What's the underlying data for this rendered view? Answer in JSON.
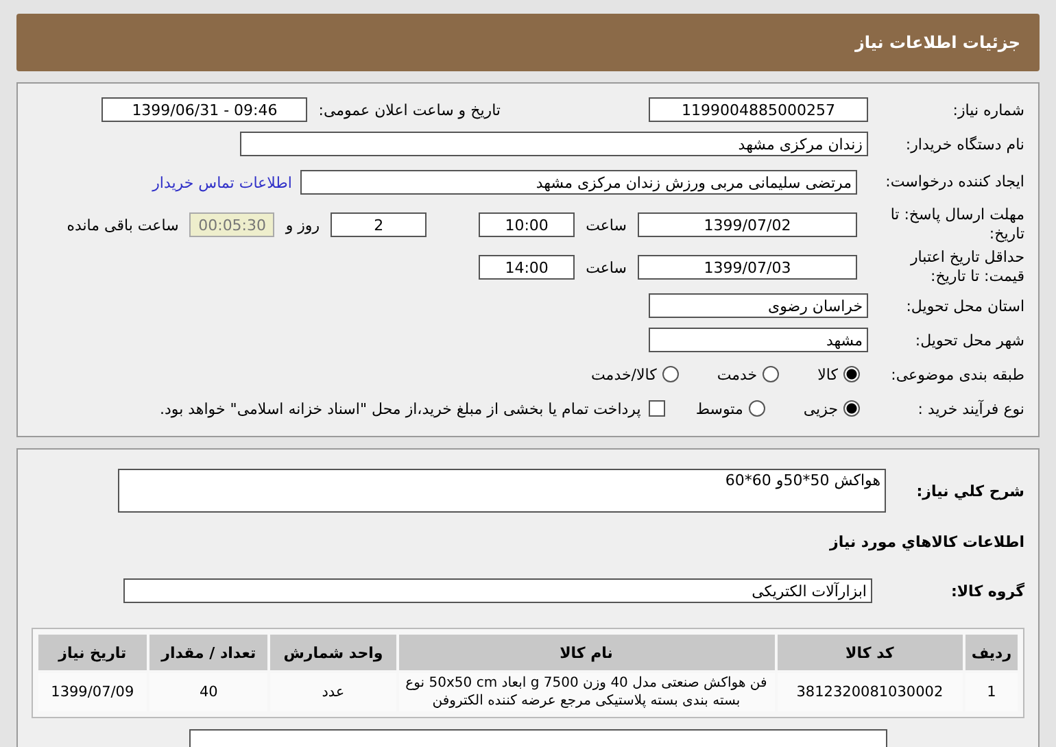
{
  "header": {
    "title": "جزئیات اطلاعات نیاز"
  },
  "need_number": {
    "label": "شماره نیاز:",
    "value": "1199004885000257"
  },
  "announce": {
    "label": "تاریخ و ساعت اعلان عمومی:",
    "value": "1399/06/31 - 09:46"
  },
  "buyer": {
    "label": "نام دستگاه خریدار:",
    "value": "زندان مرکزی مشهد"
  },
  "requester": {
    "label": "ایجاد کننده درخواست:",
    "value": "مرتضی سلیمانی مربی ورزش زندان مرکزی مشهد",
    "link": "اطلاعات تماس خریدار"
  },
  "deadline": {
    "label": "مهلت ارسال پاسخ: تا تاریخ:",
    "date": "1399/07/02",
    "time_label": "ساعت",
    "time": "10:00",
    "days": "2",
    "days_label": "روز و",
    "remaining": "00:05:30",
    "remaining_label": "ساعت باقی مانده"
  },
  "validity": {
    "label": "حداقل تاریخ اعتبار قیمت: تا تاریخ:",
    "date": "1399/07/03",
    "time_label": "ساعت",
    "time": "14:00"
  },
  "province": {
    "label": "استان محل تحویل:",
    "value": "خراسان رضوی"
  },
  "city": {
    "label": "شهر محل تحویل:",
    "value": "مشهد"
  },
  "category": {
    "label": "طبقه بندی موضوعی:",
    "options": [
      {
        "label": "کالا",
        "selected": true
      },
      {
        "label": "خدمت",
        "selected": false
      },
      {
        "label": "کالا/خدمت",
        "selected": false
      }
    ]
  },
  "process": {
    "label": "نوع فرآیند خرید :",
    "options": [
      {
        "label": "جزیی",
        "selected": true
      },
      {
        "label": "متوسط",
        "selected": false
      }
    ],
    "payment": {
      "label": "پرداخت تمام یا بخشی از مبلغ خرید،از محل \"اسناد خزانه اسلامی\" خواهد بود.",
      "checked": false
    }
  },
  "description": {
    "label": "شرح کلي نیاز:",
    "value": "هواکش 50*50و 60*60"
  },
  "goods_title": "اطلاعات کالاهاي مورد نیاز",
  "goods_group": {
    "label": "گروه کالا:",
    "value": "ابزارآلات الکتریکی"
  },
  "table": {
    "columns": [
      "ردیف",
      "کد کالا",
      "نام کالا",
      "واحد شمارش",
      "تعداد / مقدار",
      "تاریخ نیاز"
    ],
    "rows": [
      [
        "1",
        "3812320081030002",
        "فن هواکش صنعتی مدل 40 وزن 7500 g ابعاد 50x50 cm نوع بسته بندی بسته پلاستیکی مرجع عرضه کننده الکتروفن",
        "عدد",
        "40",
        "1399/07/09"
      ]
    ]
  }
}
